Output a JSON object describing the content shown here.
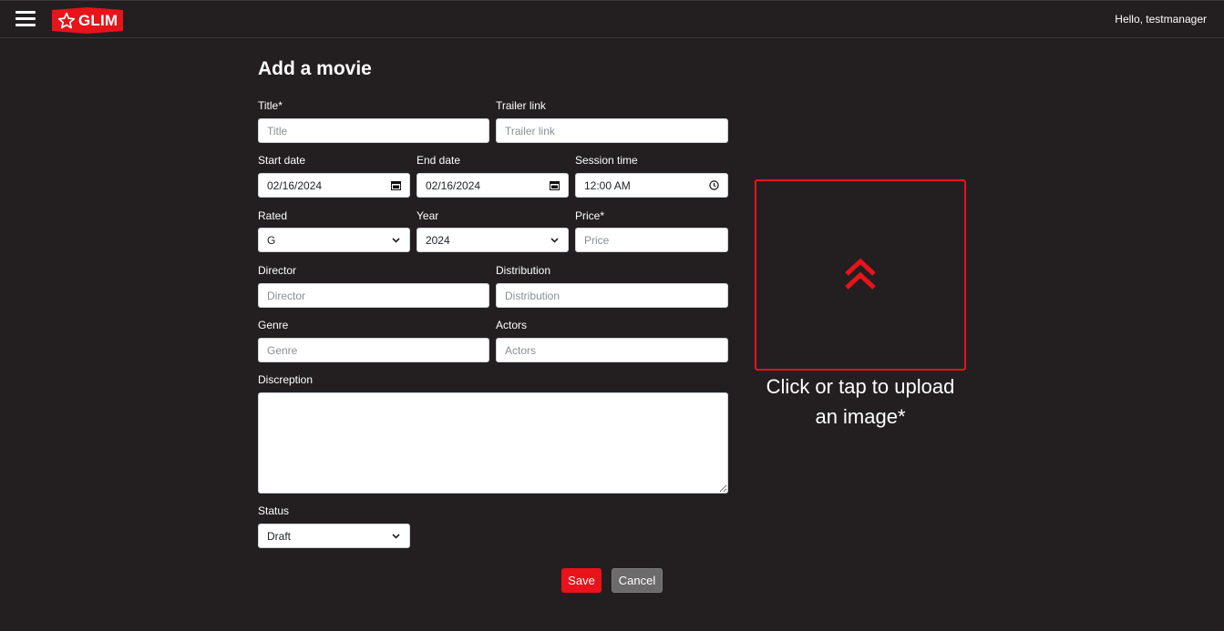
{
  "header": {
    "logo_text": "GLIM",
    "greeting": "Hello, testmanager"
  },
  "page": {
    "title": "Add a movie"
  },
  "form": {
    "title": {
      "label": "Title*",
      "placeholder": "Title"
    },
    "trailer": {
      "label": "Trailer link",
      "placeholder": "Trailer link"
    },
    "start_date": {
      "label": "Start date",
      "value": "02/16/2024"
    },
    "end_date": {
      "label": "End date",
      "value": "02/16/2024"
    },
    "session_time": {
      "label": "Session time",
      "value": "12:00 AM"
    },
    "rated": {
      "label": "Rated",
      "value": "G"
    },
    "year": {
      "label": "Year",
      "value": "2024"
    },
    "price": {
      "label": "Price*",
      "placeholder": "Price"
    },
    "director": {
      "label": "Director",
      "placeholder": "Director"
    },
    "distribution": {
      "label": "Distribution",
      "placeholder": "Distribution"
    },
    "genre": {
      "label": "Genre",
      "placeholder": "Genre"
    },
    "actors": {
      "label": "Actors",
      "placeholder": "Actors"
    },
    "description": {
      "label": "Discreption"
    },
    "status": {
      "label": "Status",
      "value": "Draft"
    }
  },
  "upload": {
    "line1": "Click or tap to upload",
    "line2": "an image*",
    "icon": "double-chevron-up-icon"
  },
  "actions": {
    "save_label": "Save",
    "cancel_label": "Cancel"
  },
  "colors": {
    "background": "#231f20",
    "accent": "#e8131b"
  }
}
